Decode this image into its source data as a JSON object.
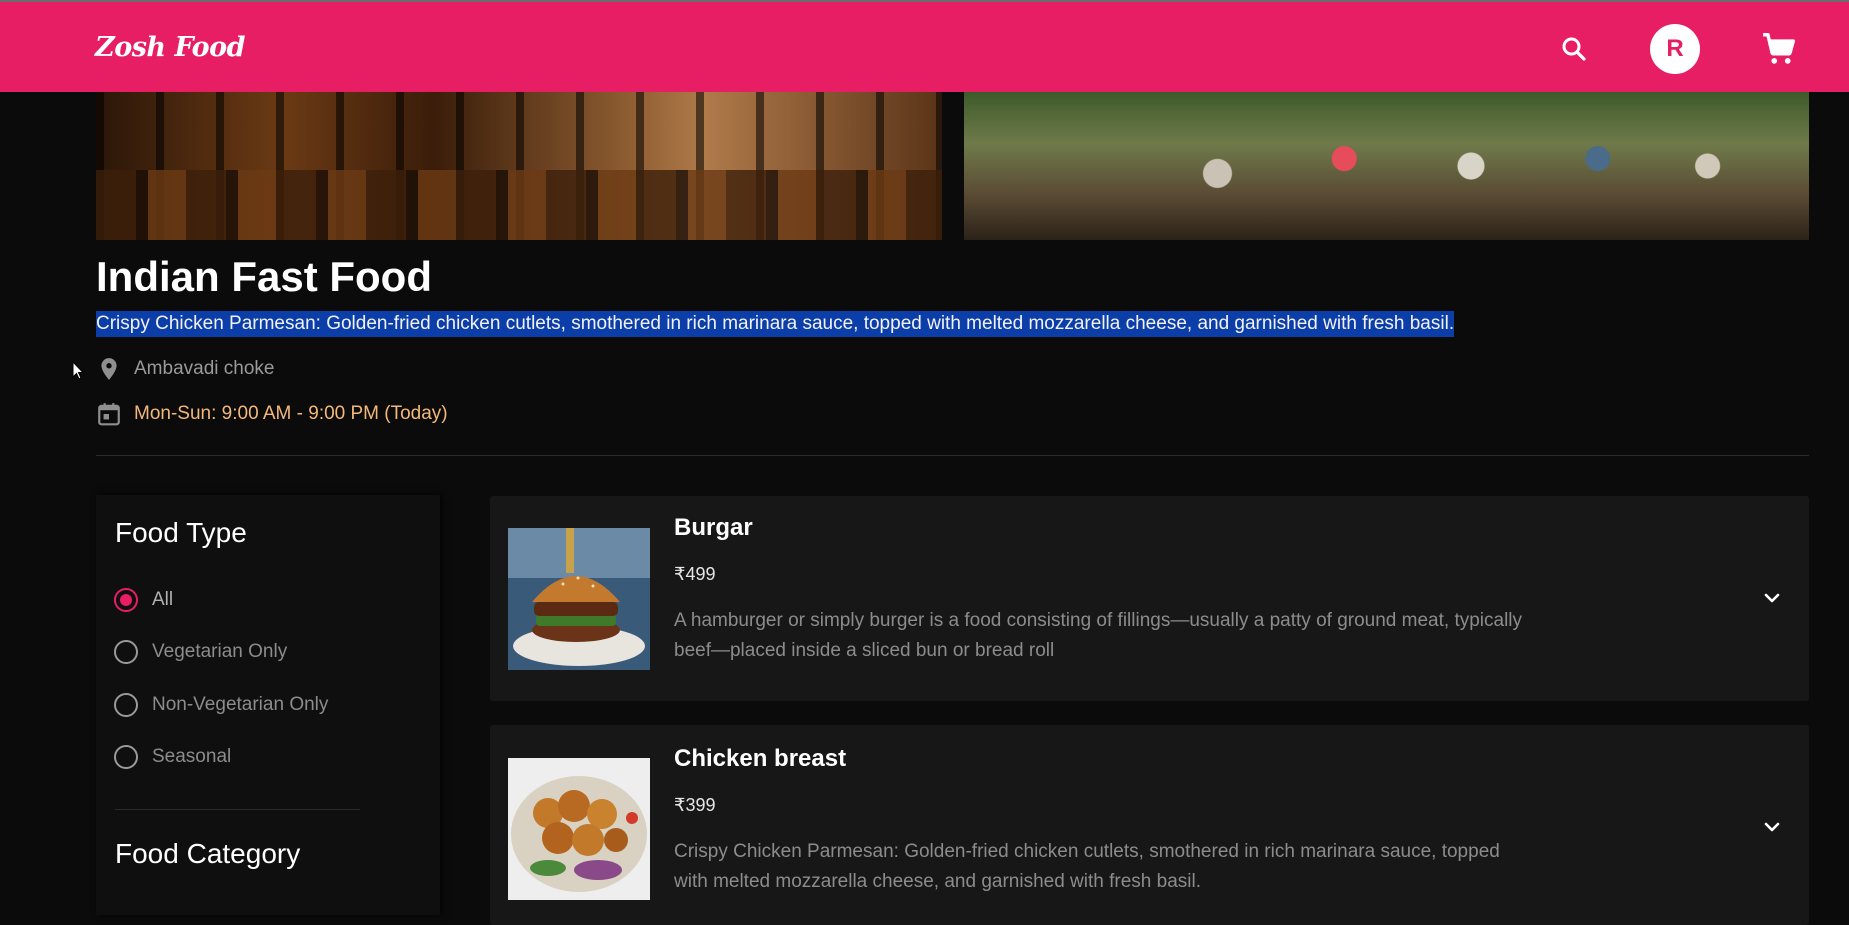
{
  "header": {
    "logo": "Zosh Food",
    "avatar_letter": "R"
  },
  "restaurant": {
    "name": "Indian Fast Food",
    "description": "Crispy Chicken Parmesan: Golden-fried chicken cutlets, smothered in rich marinara sauce, topped with melted mozzarella cheese, and garnished with fresh basil.",
    "location": "Ambavadi choke",
    "hours": "Mon-Sun: 9:00 AM - 9:00 PM (Today)"
  },
  "filters": {
    "food_type_heading": "Food Type",
    "food_type_options": [
      "All",
      "Vegetarian Only",
      "Non-Vegetarian Only",
      "Seasonal"
    ],
    "selected": "All",
    "food_category_heading": "Food Category"
  },
  "menu": [
    {
      "name": "Burgar",
      "price": "₹499",
      "description": "A hamburger or simply burger is a food consisting of fillings—usually a patty of ground meat, typically beef—placed inside a sliced bun or bread roll"
    },
    {
      "name": "Chicken breast",
      "price": "₹399",
      "description": "Crispy Chicken Parmesan: Golden-fried chicken cutlets, smothered in rich marinara sauce, topped with melted mozzarella cheese, and garnished with fresh basil."
    }
  ],
  "colors": {
    "brand": "#e71e63",
    "hours_text": "#f3b87a",
    "selection_highlight": "#0b3ea8"
  }
}
